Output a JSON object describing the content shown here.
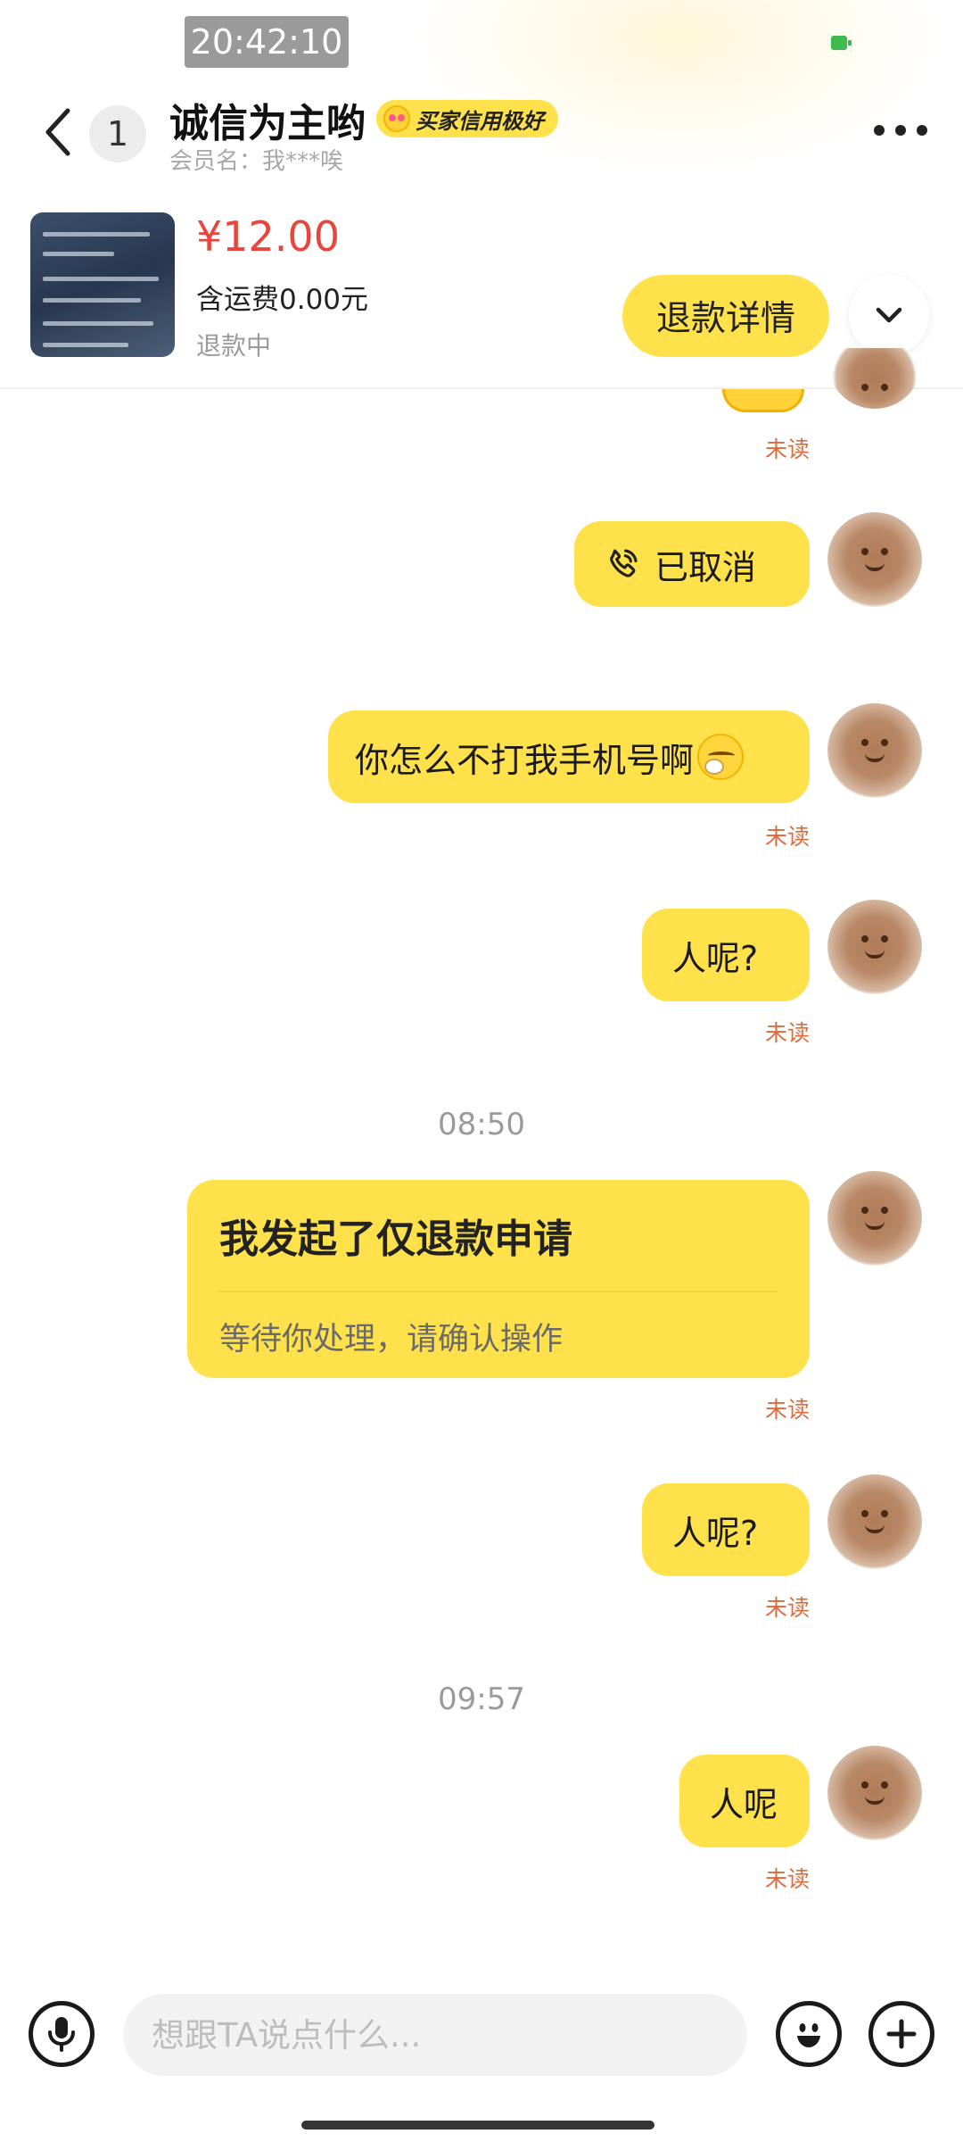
{
  "status_bar": {
    "time": "20:42:10",
    "battery_color": "#3dbb4f"
  },
  "header": {
    "back_icon": "chevron-left-icon",
    "unread_count": "1",
    "contact_name": "诚信为主哟",
    "credit_badge": "买家信用极好",
    "member_name": "会员名：我***唉",
    "more_icon": "more-dots-icon"
  },
  "product": {
    "price": "¥12.00",
    "shipping": "含运费0.00元",
    "status": "退款中",
    "refund_detail_label": "退款详情",
    "expand_icon": "chevron-down-icon"
  },
  "messages": {
    "m0_unread": "未读",
    "m1_text": "已取消",
    "m1_icon": "phone-call-icon",
    "m2_text": "你怎么不打我手机号啊",
    "m2_unread": "未读",
    "m3_text": "人呢?",
    "m3_unread": "未读",
    "ts1": "08:50",
    "card_title": "我发起了仅退款申请",
    "card_desc": "等待你处理，请确认操作",
    "card_unread": "未读",
    "m4_text": "人呢?",
    "m4_unread": "未读",
    "ts2": "09:57",
    "m5_text": "人呢",
    "m5_unread": "未读"
  },
  "input_bar": {
    "placeholder": "想跟TA说点什么...",
    "voice_icon": "microphone-icon",
    "emoji_icon": "smiley-icon",
    "plus_icon": "plus-icon"
  },
  "colors": {
    "bubble": "#ffe24b",
    "price": "#e8453c",
    "unread": "#e06a3a"
  }
}
